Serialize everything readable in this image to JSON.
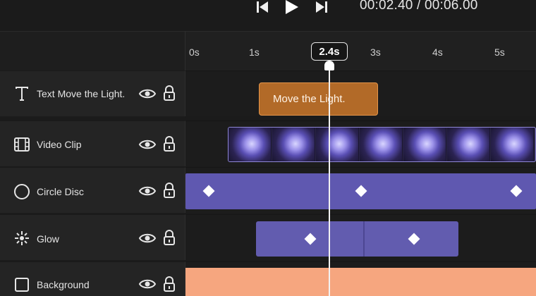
{
  "transport": {
    "prev_icon": "skip-back-icon",
    "play_icon": "play-icon",
    "next_icon": "skip-forward-icon",
    "current_time": "00:02.40",
    "separator": "/",
    "duration": "00:06.00"
  },
  "ruler": {
    "ticks": [
      "0s",
      "1s",
      "3s",
      "4s",
      "5s"
    ],
    "playhead_label": "2.4s",
    "playhead_seconds": 2.4
  },
  "tracks": [
    {
      "label": "Text Move the Light.",
      "icon": "text-icon"
    },
    {
      "label": "Video Clip",
      "icon": "film-icon"
    },
    {
      "label": "Circle Disc",
      "icon": "circle-icon"
    },
    {
      "label": "Glow",
      "icon": "sparkle-icon"
    },
    {
      "label": "Background",
      "icon": "square-icon"
    }
  ],
  "clips": {
    "text_clip": "Move the Light."
  },
  "colors": {
    "text_clip": "#b26a28",
    "video_clip": "#8f87d6",
    "disc_clip": "#5f58b0",
    "glow_clip": "#625caf",
    "background_clip": "#f6a67f",
    "playhead": "#ffffff"
  }
}
